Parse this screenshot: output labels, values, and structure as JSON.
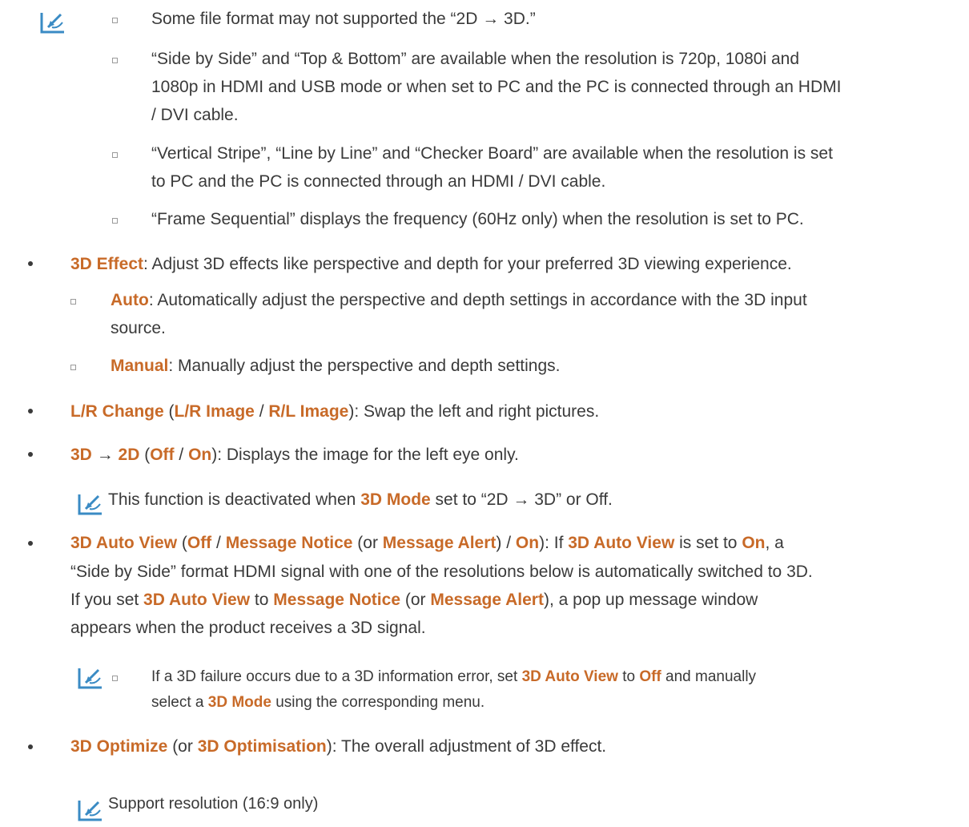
{
  "notes_top": [
    "Some file format may not supported the “2D → 3D.”",
    [
      "“Side by Side” and “Top & Bottom” are available when the resolution is 720p, 1080i and",
      "1080p in HDMI and USB mode or when set to PC and the PC is connected through an HDMI",
      "/ DVI cable."
    ],
    [
      "“Vertical Stripe”, “Line by Line” and “Checker Board” are available when the resolution is set",
      "to PC and the PC is connected through an HDMI / DVI cable."
    ],
    "“Frame Sequential” displays the frequency (60Hz only) when the resolution is set to PC."
  ],
  "effect": {
    "label": "3D Effect",
    "text": ": Adjust 3D effects like perspective and depth for your preferred 3D viewing experience.",
    "auto_label": "Auto",
    "auto_text1": ": Automatically adjust the perspective and depth settings in accordance with the 3D input",
    "auto_text2": "source.",
    "manual_label": "Manual",
    "manual_text": ": Manually adjust the perspective and depth settings."
  },
  "lr": {
    "label": "L/R Change",
    "p1": " (",
    "opt1": "L/R Image",
    "sep": " / ",
    "opt2": "R/L Image",
    "text": "): Swap the left and right pictures."
  },
  "to2d": {
    "a": "3D",
    "arrow": " → ",
    "b": "2D",
    "p1": " (",
    "off": "Off",
    "sep": " / ",
    "on": "On",
    "text": "): Displays the image for the left eye only.",
    "note_pre": "This function is deactivated when ",
    "note_hl": "3D Mode",
    "note_post": " set to “2D → 3D” or Off."
  },
  "autoview": {
    "l1_label": "3D Auto View",
    "l1_p": " (",
    "l1_off": "Off",
    "l1_sep": " / ",
    "l1_msg": "Message Notice",
    "l1_or": " (or ",
    "l1_alert": "Message Alert",
    "l1_close": ") / ",
    "l1_on": "On",
    "l1_if": "): If ",
    "l1_label2": "3D Auto View",
    "l1_set": " is set to ",
    "l1_on2": "On",
    "l1_a": ", a",
    "l2": "“Side by Side” format HDMI signal with one of the resolutions below is automatically switched to 3D.",
    "l3_pre": "If you set ",
    "l3_label": "3D Auto View",
    "l3_to": " to ",
    "l3_msg": "Message Notice",
    "l3_or": " (or ",
    "l3_alert": "Message Alert",
    "l3_post": "), a pop up message window",
    "l4": "appears when the product receives a 3D signal.",
    "n1_pre": "If a 3D failure occurs due to a 3D information error, set ",
    "n1_label": "3D Auto View",
    "n1_to": " to ",
    "n1_off": "Off",
    "n1_post": " and manually",
    "n2_pre": "select a ",
    "n2_label": "3D Mode",
    "n2_post": " using the corresponding menu."
  },
  "optimize": {
    "label": "3D Optimize",
    "p1": " (or ",
    "label2": "3D Optimisation",
    "text": "): The overall adjustment of 3D effect."
  },
  "support": "Support resolution (16:9 only)",
  "colors": {
    "accent": "#c86a28",
    "text": "#3a3a3a",
    "note_icon": "#3a8bc4"
  }
}
